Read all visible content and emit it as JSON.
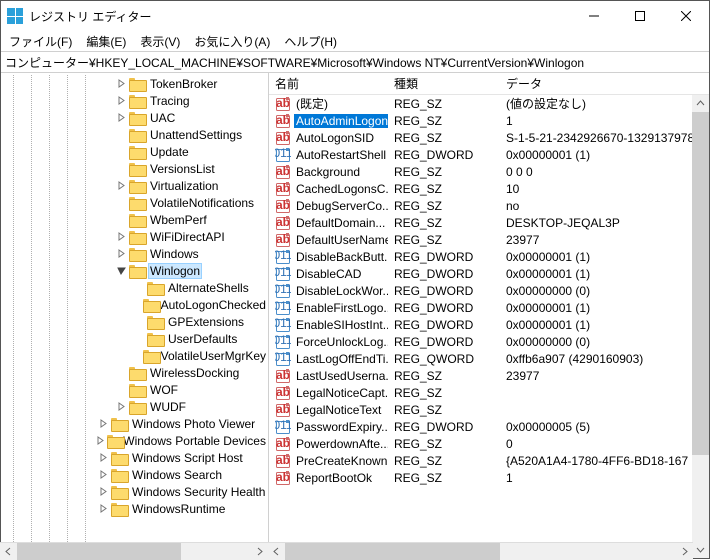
{
  "window": {
    "title": "レジストリ エディター"
  },
  "menu": {
    "file": "ファイル(F)",
    "edit": "編集(E)",
    "view": "表示(V)",
    "favorites": "お気に入り(A)",
    "help": "ヘルプ(H)"
  },
  "address": "コンピューター¥HKEY_LOCAL_MACHINE¥SOFTWARE¥Microsoft¥Windows NT¥CurrentVersion¥Winlogon",
  "tree": [
    {
      "indent": 6,
      "exp": "closed",
      "label": "TokenBroker"
    },
    {
      "indent": 6,
      "exp": "closed",
      "label": "Tracing"
    },
    {
      "indent": 6,
      "exp": "closed",
      "label": "UAC"
    },
    {
      "indent": 6,
      "exp": "none",
      "label": "UnattendSettings"
    },
    {
      "indent": 6,
      "exp": "none",
      "label": "Update"
    },
    {
      "indent": 6,
      "exp": "none",
      "label": "VersionsList"
    },
    {
      "indent": 6,
      "exp": "closed",
      "label": "Virtualization"
    },
    {
      "indent": 6,
      "exp": "none",
      "label": "VolatileNotifications"
    },
    {
      "indent": 6,
      "exp": "none",
      "label": "WbemPerf"
    },
    {
      "indent": 6,
      "exp": "closed",
      "label": "WiFiDirectAPI"
    },
    {
      "indent": 6,
      "exp": "closed",
      "label": "Windows"
    },
    {
      "indent": 6,
      "exp": "open",
      "label": "Winlogon",
      "sel": true
    },
    {
      "indent": 7,
      "exp": "none",
      "label": "AlternateShells"
    },
    {
      "indent": 7,
      "exp": "none",
      "label": "AutoLogonChecked"
    },
    {
      "indent": 7,
      "exp": "none",
      "label": "GPExtensions"
    },
    {
      "indent": 7,
      "exp": "none",
      "label": "UserDefaults"
    },
    {
      "indent": 7,
      "exp": "none",
      "label": "VolatileUserMgrKey"
    },
    {
      "indent": 6,
      "exp": "none",
      "label": "WirelessDocking"
    },
    {
      "indent": 6,
      "exp": "none",
      "label": "WOF"
    },
    {
      "indent": 6,
      "exp": "closed",
      "label": "WUDF"
    },
    {
      "indent": 5,
      "exp": "closed",
      "label": "Windows Photo Viewer"
    },
    {
      "indent": 5,
      "exp": "closed",
      "label": "Windows Portable Devices"
    },
    {
      "indent": 5,
      "exp": "closed",
      "label": "Windows Script Host"
    },
    {
      "indent": 5,
      "exp": "closed",
      "label": "Windows Search"
    },
    {
      "indent": 5,
      "exp": "closed",
      "label": "Windows Security Health"
    },
    {
      "indent": 5,
      "exp": "closed",
      "label": "WindowsRuntime"
    }
  ],
  "columns": {
    "name": "名前",
    "type": "種類",
    "data": "データ"
  },
  "values": [
    {
      "icon": "sz",
      "name": "(既定)",
      "type": "REG_SZ",
      "data": "(値の設定なし)"
    },
    {
      "icon": "sz",
      "name": "AutoAdminLogon",
      "type": "REG_SZ",
      "data": "1",
      "sel": true
    },
    {
      "icon": "sz",
      "name": "AutoLogonSID",
      "type": "REG_SZ",
      "data": "S-1-5-21-2342926670-1329137978"
    },
    {
      "icon": "bin",
      "name": "AutoRestartShell",
      "type": "REG_DWORD",
      "data": "0x00000001 (1)"
    },
    {
      "icon": "sz",
      "name": "Background",
      "type": "REG_SZ",
      "data": "0 0 0"
    },
    {
      "icon": "sz",
      "name": "CachedLogonsC...",
      "type": "REG_SZ",
      "data": "10"
    },
    {
      "icon": "sz",
      "name": "DebugServerCo...",
      "type": "REG_SZ",
      "data": "no"
    },
    {
      "icon": "sz",
      "name": "DefaultDomain...",
      "type": "REG_SZ",
      "data": "DESKTOP-JEQAL3P"
    },
    {
      "icon": "sz",
      "name": "DefaultUserName",
      "type": "REG_SZ",
      "data": "23977"
    },
    {
      "icon": "bin",
      "name": "DisableBackButt...",
      "type": "REG_DWORD",
      "data": "0x00000001 (1)"
    },
    {
      "icon": "bin",
      "name": "DisableCAD",
      "type": "REG_DWORD",
      "data": "0x00000001 (1)"
    },
    {
      "icon": "bin",
      "name": "DisableLockWor...",
      "type": "REG_DWORD",
      "data": "0x00000000 (0)"
    },
    {
      "icon": "bin",
      "name": "EnableFirstLogo...",
      "type": "REG_DWORD",
      "data": "0x00000001 (1)"
    },
    {
      "icon": "bin",
      "name": "EnableSIHostInt...",
      "type": "REG_DWORD",
      "data": "0x00000001 (1)"
    },
    {
      "icon": "bin",
      "name": "ForceUnlockLog...",
      "type": "REG_DWORD",
      "data": "0x00000000 (0)"
    },
    {
      "icon": "bin",
      "name": "LastLogOffEndTi...",
      "type": "REG_QWORD",
      "data": "0xffb6a907 (4290160903)"
    },
    {
      "icon": "sz",
      "name": "LastUsedUserna...",
      "type": "REG_SZ",
      "data": "23977"
    },
    {
      "icon": "sz",
      "name": "LegalNoticeCapt...",
      "type": "REG_SZ",
      "data": ""
    },
    {
      "icon": "sz",
      "name": "LegalNoticeText",
      "type": "REG_SZ",
      "data": ""
    },
    {
      "icon": "bin",
      "name": "PasswordExpiry...",
      "type": "REG_DWORD",
      "data": "0x00000005 (5)"
    },
    {
      "icon": "sz",
      "name": "PowerdownAfte...",
      "type": "REG_SZ",
      "data": "0"
    },
    {
      "icon": "sz",
      "name": "PreCreateKnown...",
      "type": "REG_SZ",
      "data": "{A520A1A4-1780-4FF6-BD18-167"
    },
    {
      "icon": "sz",
      "name": "ReportBootOk",
      "type": "REG_SZ",
      "data": "1"
    }
  ]
}
